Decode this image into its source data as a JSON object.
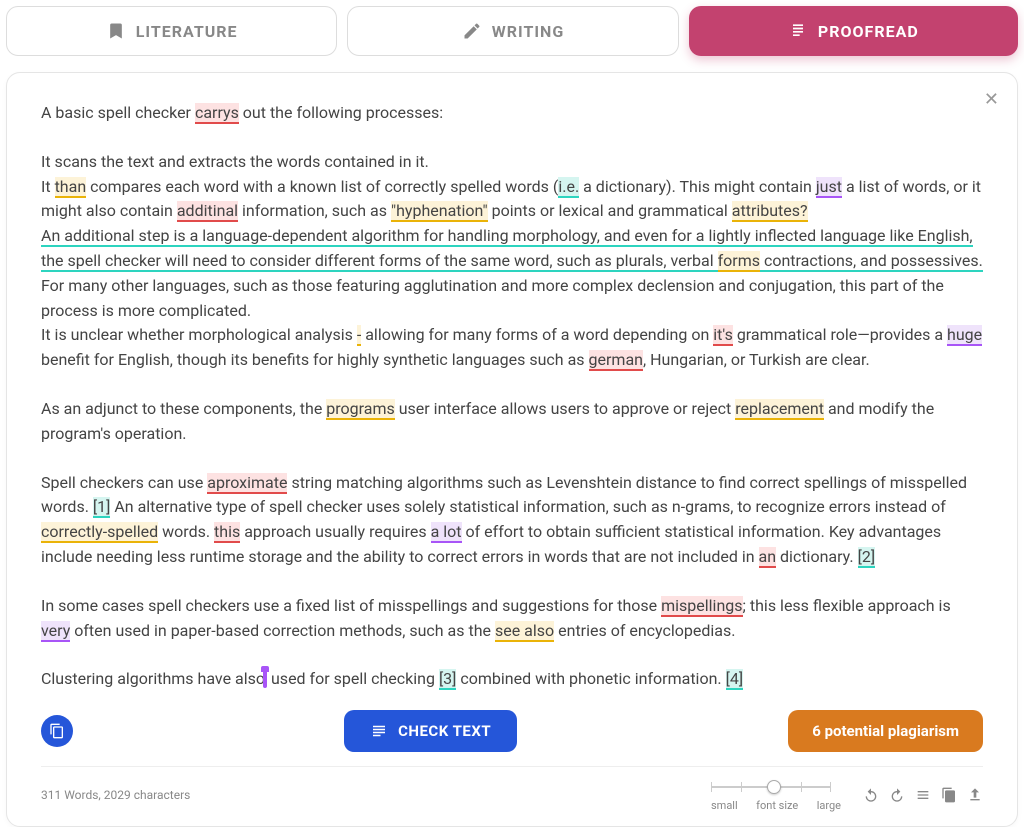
{
  "tabs": {
    "literature": "LITERATURE",
    "writing": "WRITING",
    "proofread": "PROOFREAD"
  },
  "doc": {
    "p1_a": "A basic spell checker ",
    "p1_carrys": "carrys",
    "p1_b": " out the following processes:",
    "p2": "It scans the text and extracts the words contained in it.",
    "p3_a": "It ",
    "p3_than": "than",
    "p3_b": " compares each word with a known list of correctly spelled words (",
    "p3_ie": "i.e.",
    "p3_c": " a dictionary). This might contain ",
    "p3_just": "just",
    "p3_d": " a list of words, or it might also contain ",
    "p3_additinal": "additinal",
    "p3_e": " information, such as ",
    "p3_hyph": "\"hyphenation\"",
    "p3_f": " points or lexical and grammatical ",
    "p3_attr": "attributes?",
    "p4_a": "An additional step is a language-dependent algorithm for handling morphology, and even for a lightly inflected language like English, the spell checker will need to consider different forms of the same word, such as plurals, verbal ",
    "p4_forms": "forms",
    "p4_b": " contractions, and possessives.",
    "p4_c": " For many other languages, such as those featuring agglutination and more complex declension and conjugation, this part of the process is more complicated.",
    "p5_a": "It is unclear whether morphological analysis ",
    "p5_dash": "-",
    "p5_b": " allowing for many forms of a word depending on ",
    "p5_its": "it's",
    "p5_c": " grammatical role—provides a ",
    "p5_huge": "huge",
    "p5_d": " benefit for English, though its benefits for highly synthetic languages such as ",
    "p5_german": "german",
    "p5_e": ", Hungarian, or Turkish are clear.",
    "p6_a": "As an adjunct to these components, the ",
    "p6_programs": "programs",
    "p6_b": " user interface allows users to approve or reject ",
    "p6_replacement": "replacement",
    "p6_c": " and modify the program's operation.",
    "p7_a": "Spell checkers can use ",
    "p7_aprox": "aproximate",
    "p7_b": " string matching algorithms such as Levenshtein distance to find correct spellings of misspelled words. ",
    "p7_ref1": "[1]",
    "p7_c": " An alternative type of spell checker uses solely statistical information, such as n-grams, to recognize errors instead of ",
    "p7_correctly": "correctly-spelled",
    "p7_d": " words. ",
    "p7_this": "this",
    "p7_e": " approach usually requires ",
    "p7_alot": "a lot",
    "p7_f": " of effort to obtain sufficient statistical information. Key advantages include needing less runtime storage and the ability to correct errors in words that are not included in ",
    "p7_an": "an",
    "p7_g": " dictionary. ",
    "p7_ref2": "[2]",
    "p8_a": "In some cases spell checkers use a fixed list of misspellings and suggestions for those ",
    "p8_misp": "mispellings",
    "p8_b": "; this less flexible approach is ",
    "p8_very": "very",
    "p8_c": " often used in paper-based correction methods, such as the ",
    "p8_seealso": "see also",
    "p8_d": " entries of encyclopedias.",
    "p9_a": "Clustering algorithms have ",
    "p9_also": "also",
    "p9_b": " used for spell checking ",
    "p9_ref3": "[3]",
    "p9_c": " combined with phonetic information. ",
    "p9_ref4": "[4]"
  },
  "actions": {
    "check": "CHECK TEXT",
    "plagiarism": "6 potential plagiarism"
  },
  "footer": {
    "stats": "311 Words, 2029 characters",
    "small": "small",
    "fontsize": "font size",
    "large": "large"
  }
}
